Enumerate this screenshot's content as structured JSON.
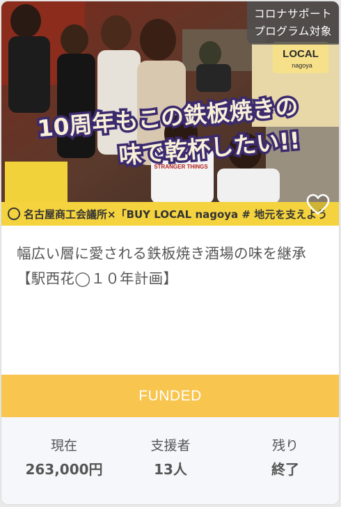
{
  "badge": {
    "line1": "コロナサポート",
    "line2": "プログラム対象"
  },
  "image": {
    "headline_line1": "10周年もこの鉄板焼きの",
    "headline_line2": "味で乾杯したい!!",
    "banner_text": "名古屋商工会議所×「BUY LOCAL nagoya # 地元を支えよう",
    "sign_text": "LOCAL",
    "sign_subtext": "nagoya",
    "shirt_text": "STRANGER THINGS"
  },
  "project": {
    "title": "幅広い層に愛される鉄板焼き酒場の味を継承【駅西花◯１０年計画】"
  },
  "status": {
    "label": "FUNDED",
    "color": "#f8c54f"
  },
  "stats": {
    "current_label": "現在",
    "current_value": "263,000円",
    "supporters_label": "支援者",
    "supporters_value": "13人",
    "remaining_label": "残り",
    "remaining_value": "終了"
  },
  "icons": {
    "favorite": "heart-outline-icon"
  }
}
